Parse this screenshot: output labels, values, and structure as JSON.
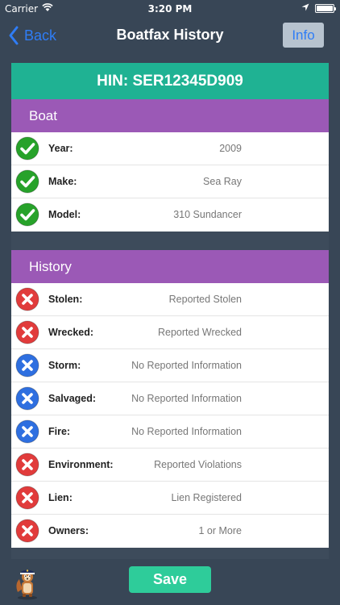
{
  "status_bar": {
    "carrier": "Carrier",
    "time": "3:20 PM"
  },
  "nav": {
    "back_label": "Back",
    "title": "Boatfax History",
    "info_label": "Info"
  },
  "hin": "HIN: SER12345D909",
  "boat": {
    "header": "Boat",
    "rows": [
      {
        "label": "Year:",
        "value": "2009",
        "status": "ok"
      },
      {
        "label": "Make:",
        "value": "Sea Ray",
        "status": "ok"
      },
      {
        "label": "Model:",
        "value": "310 Sundancer",
        "status": "ok"
      }
    ]
  },
  "history": {
    "header": "History",
    "rows": [
      {
        "label": "Stolen:",
        "value": "Reported Stolen",
        "status": "alert"
      },
      {
        "label": "Wrecked:",
        "value": "Reported Wrecked",
        "status": "alert"
      },
      {
        "label": "Storm:",
        "value": "No Reported Information",
        "status": "none"
      },
      {
        "label": "Salvaged:",
        "value": "No Reported Information",
        "status": "none"
      },
      {
        "label": "Fire:",
        "value": "No Reported Information",
        "status": "none"
      },
      {
        "label": "Environment:",
        "value": "Reported Violations",
        "status": "alert"
      },
      {
        "label": "Lien:",
        "value": "Lien Registered",
        "status": "alert"
      },
      {
        "label": "Owners:",
        "value": "1 or More",
        "status": "alert"
      }
    ]
  },
  "save_label": "Save",
  "colors": {
    "background": "#384656",
    "hin_bar": "#1fb293",
    "section_header": "#9b59b6",
    "ok": "#27a22a",
    "alert": "#e13b3b",
    "none": "#2e6fe0",
    "link": "#2f7df6",
    "save": "#2ecc9a"
  },
  "icons": {
    "ok": "check-circle-icon",
    "alert": "x-circle-icon",
    "none": "x-circle-icon",
    "back": "chevron-left-icon",
    "wifi": "wifi-icon",
    "location": "location-arrow-icon",
    "battery": "battery-icon",
    "mascot": "mascot-icon"
  }
}
